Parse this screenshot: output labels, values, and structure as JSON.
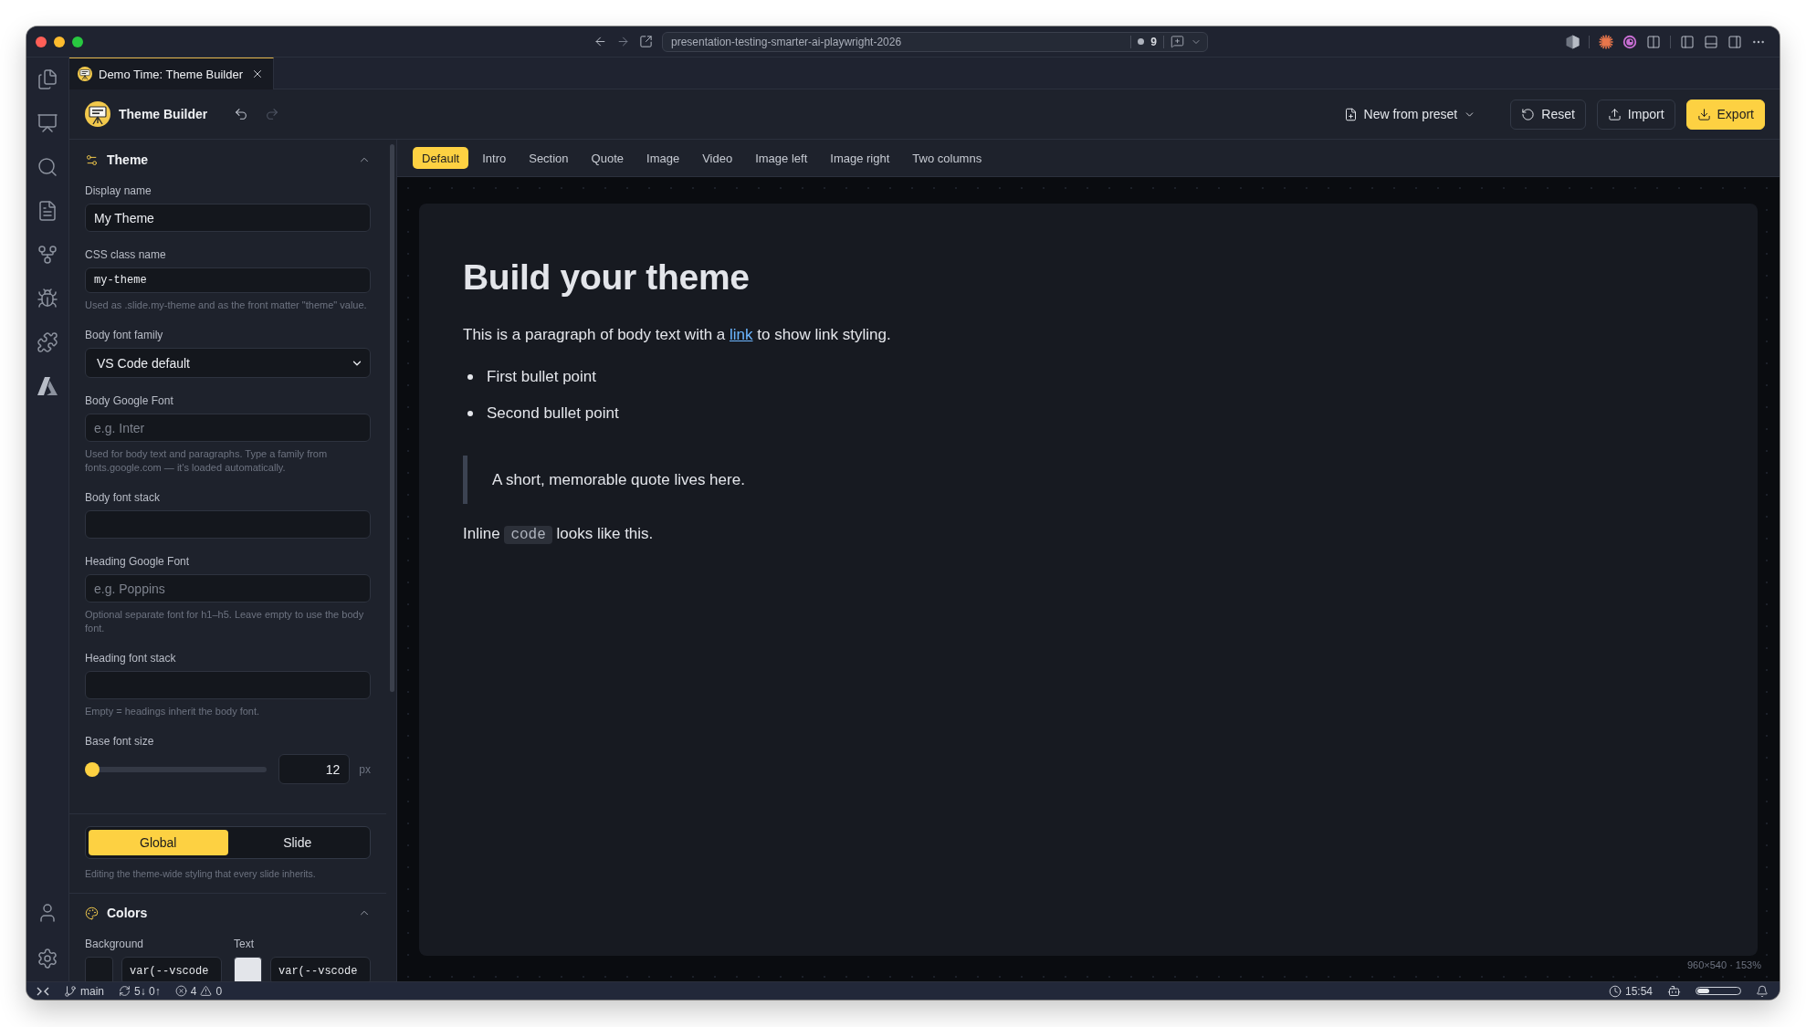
{
  "title_bar": {
    "address": "presentation-testing-smarter-ai-playwright-2026",
    "count": "9"
  },
  "editor_tab": {
    "title": "Demo Time: Theme Builder"
  },
  "toolbar": {
    "title": "Theme Builder",
    "history": [
      {
        "kind": "undo",
        "disabled": false
      },
      {
        "kind": "redo",
        "disabled": true
      }
    ],
    "buttons": [
      {
        "label": "New from preset",
        "kind": "menu",
        "primary": false
      },
      {
        "label": "Reset",
        "kind": "reset",
        "primary": false
      },
      {
        "label": "Import",
        "kind": "import",
        "primary": false
      },
      {
        "label": "Export",
        "kind": "export",
        "primary": true
      }
    ]
  },
  "theme_panel": {
    "title": "Theme",
    "expanded": true,
    "fields": [
      {
        "kind": "text",
        "label": "Display name",
        "value": "My Theme"
      },
      {
        "kind": "code",
        "label": "CSS class name",
        "value": "my-theme",
        "help": "Used as .slide.my-theme and as the front matter \"theme\" value."
      },
      {
        "kind": "select",
        "label": "Body font family",
        "value": "VS Code default"
      },
      {
        "kind": "text",
        "label": "Body Google Font",
        "placeholder": "e.g. Inter",
        "help": "Used for body text and paragraphs. Type a family from fonts.google.com — it's loaded automatically."
      },
      {
        "kind": "text",
        "label": "Body font stack"
      },
      {
        "kind": "text",
        "label": "Heading Google Font",
        "placeholder": "e.g. Poppins",
        "help": "Optional separate font for h1–h5. Leave empty to use the body font."
      },
      {
        "kind": "text",
        "label": "Heading font stack",
        "help": "Empty = headings inherit the body font."
      },
      {
        "kind": "slider",
        "label": "Base font size",
        "level": 0,
        "value": "12",
        "unit": "px"
      }
    ]
  },
  "scope": {
    "options": [
      {
        "label": "Global",
        "selected": true
      },
      {
        "label": "Slide",
        "selected": false
      }
    ],
    "help": "Editing the theme-wide styling that every slide inherits."
  },
  "colors_panel": {
    "title": "Colors",
    "expanded": true,
    "items": [
      {
        "label": "Background",
        "color": "#15181e",
        "value": "var(--vscode"
      },
      {
        "label": "Text",
        "color": "#e3e5ea",
        "value": "var(--vscode"
      }
    ]
  },
  "preview": {
    "layouts": [
      {
        "label": "Default",
        "selected": true
      },
      {
        "label": "Intro",
        "selected": false
      },
      {
        "label": "Section",
        "selected": false
      },
      {
        "label": "Quote",
        "selected": false
      },
      {
        "label": "Image",
        "selected": false
      },
      {
        "label": "Video",
        "selected": false
      },
      {
        "label": "Image left",
        "selected": false
      },
      {
        "label": "Image right",
        "selected": false
      },
      {
        "label": "Two columns",
        "selected": false
      }
    ],
    "slide": {
      "heading": "Build your theme",
      "paragraph": {
        "before": "This is a paragraph of body text with a ",
        "link": "link",
        "after": " to show link styling."
      },
      "bullets": [
        "First bullet point",
        "Second bullet point"
      ],
      "quote": "A short, memorable quote lives here.",
      "code_line": {
        "before": "Inline ",
        "code": "code",
        "after": " looks like this."
      }
    },
    "size_info": "960×540 · 153%"
  },
  "status_bar": {
    "branch": "main",
    "sync": "5↓ 0↑",
    "errors": "4",
    "warnings": "0",
    "time": "15:54",
    "usage": {
      "level": 0.28
    }
  }
}
